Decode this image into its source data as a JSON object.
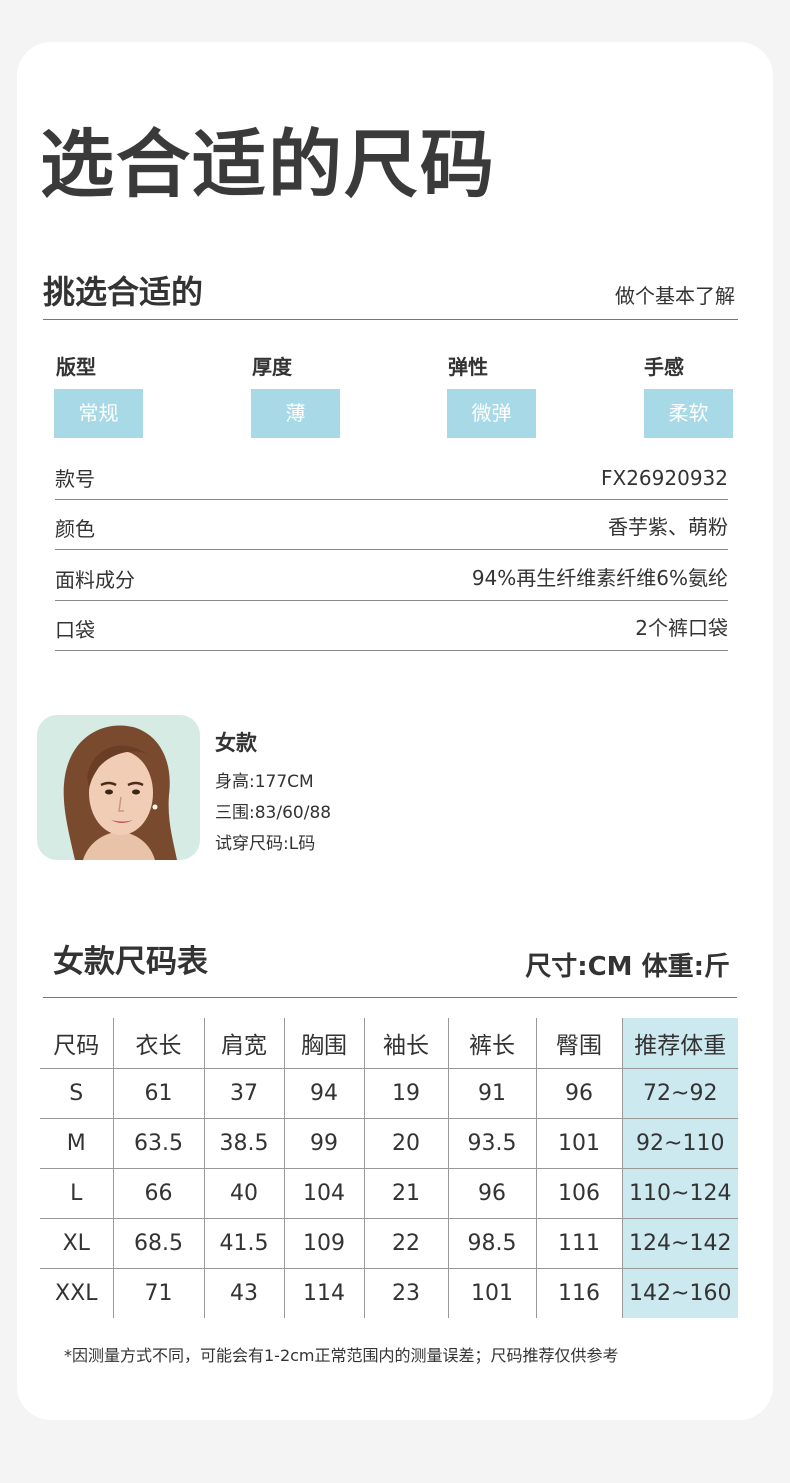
{
  "title": "选合适的尺码",
  "section": {
    "title": "挑选合适的",
    "subtitle": "做个基本了解"
  },
  "attributes": [
    {
      "label": "版型",
      "value": "常规"
    },
    {
      "label": "厚度",
      "value": "薄"
    },
    {
      "label": "弹性",
      "value": "微弹"
    },
    {
      "label": "手感",
      "value": "柔软"
    }
  ],
  "info": [
    {
      "label": "款号",
      "value": "FX26920932"
    },
    {
      "label": "颜色",
      "value": "香芋紫、萌粉"
    },
    {
      "label": "面料成分",
      "value": "94%再生纤维素纤维6%氨纶"
    },
    {
      "label": "口袋",
      "value": "2个裤口袋"
    }
  ],
  "model": {
    "title": "女款",
    "height": "身高:177CM",
    "measurements": "三围:83/60/88",
    "size": "试穿尺码:L码"
  },
  "chart": {
    "title": "女款尺码表",
    "unit": "尺寸:CM 体重:斤",
    "headers": [
      "尺码",
      "衣长",
      "肩宽",
      "胸围",
      "袖长",
      "裤长",
      "臀围",
      "推荐体重"
    ],
    "rows": [
      [
        "S",
        "61",
        "37",
        "94",
        "19",
        "91",
        "96",
        "72~92"
      ],
      [
        "M",
        "63.5",
        "38.5",
        "99",
        "20",
        "93.5",
        "101",
        "92~110"
      ],
      [
        "L",
        "66",
        "40",
        "104",
        "21",
        "96",
        "106",
        "110~124"
      ],
      [
        "XL",
        "68.5",
        "41.5",
        "109",
        "22",
        "98.5",
        "111",
        "124~142"
      ],
      [
        "XXL",
        "71",
        "43",
        "114",
        "23",
        "101",
        "116",
        "142~160"
      ]
    ]
  },
  "footnote": "*因测量方式不同，可能会有1-2cm正常范围内的测量误差；尺码推荐仅供参考",
  "colors": {
    "tag": "#a7d9e6",
    "highlight": "#cde9f0",
    "background": "#f4f4f4"
  }
}
